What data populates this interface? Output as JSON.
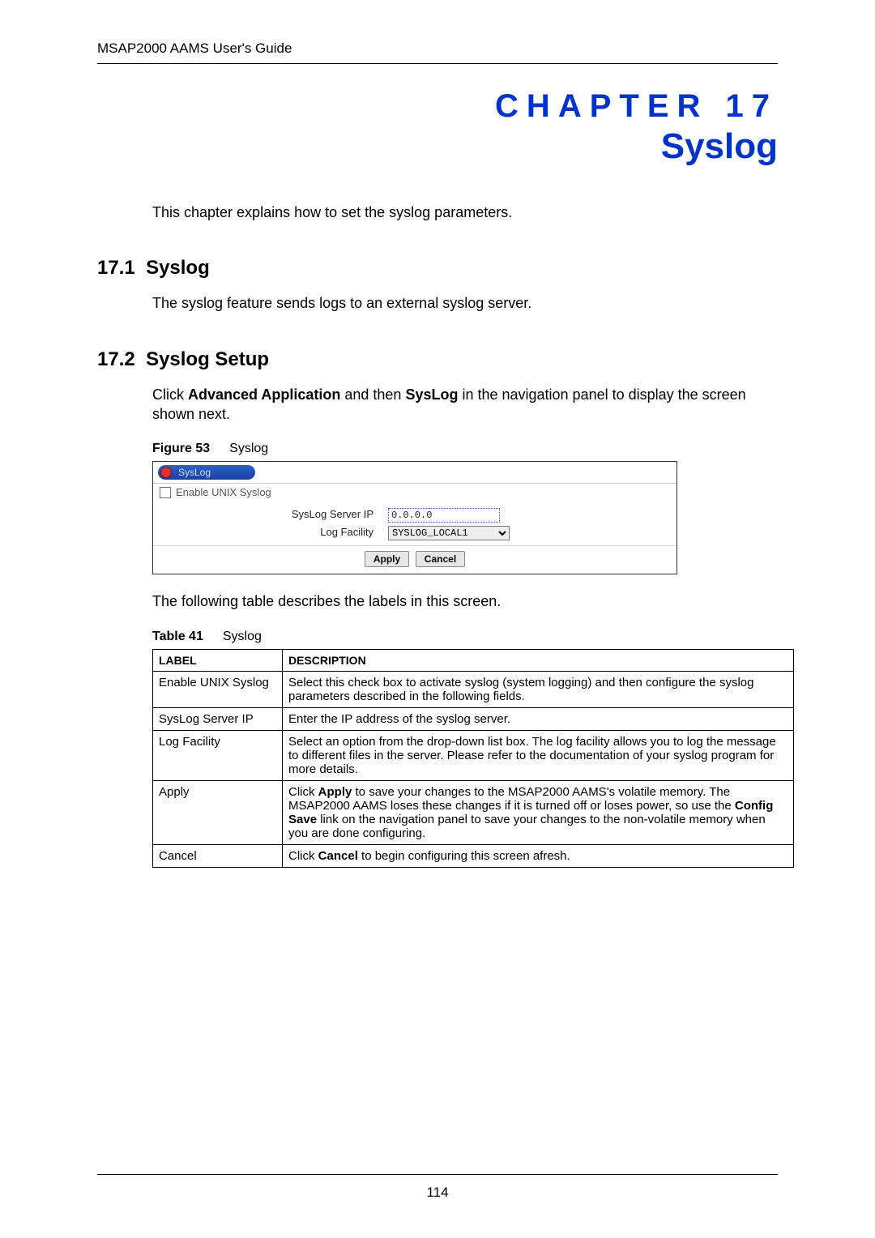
{
  "header": {
    "doc_title": "MSAP2000 AAMS User's Guide"
  },
  "chapter": {
    "label": "CHAPTER 17",
    "title": "Syslog",
    "intro": "This chapter explains how to set the syslog parameters."
  },
  "section1": {
    "number": "17.1",
    "title": "Syslog",
    "body": "The syslog feature sends logs to an external syslog server."
  },
  "section2": {
    "number": "17.2",
    "title": "Syslog Setup",
    "body_pre": "Click ",
    "body_b1": "Advanced Application",
    "body_mid1": " and then ",
    "body_b2": "SysLog",
    "body_post": " in the navigation panel to display the screen shown next."
  },
  "figure": {
    "caption_label": "Figure 53",
    "caption_text": "Syslog",
    "panel_title": "SysLog",
    "enable_label": "Enable UNIX Syslog",
    "enable_checked": false,
    "row_server_label": "SysLog Server IP",
    "row_server_value": "0.0.0.0",
    "row_facility_label": "Log Facility",
    "row_facility_value": "SYSLOG_LOCAL1",
    "apply_label": "Apply",
    "cancel_label": "Cancel"
  },
  "between_text": "The following table describes the labels in this screen.",
  "table": {
    "caption_label": "Table 41",
    "caption_text": "Syslog",
    "header_label": "LABEL",
    "header_desc": "DESCRIPTION",
    "rows": [
      {
        "label": "Enable UNIX Syslog",
        "desc": "Select this check box to activate syslog (system logging) and then configure the syslog parameters described in the following fields."
      },
      {
        "label": "SysLog Server IP",
        "desc": "Enter the IP address of the syslog server."
      },
      {
        "label": "Log Facility",
        "desc": "Select an option from the drop-down list box. The log facility allows you to log the message to different files in the server. Please refer to the documentation of your syslog program for more details."
      },
      {
        "label": "Apply",
        "desc_pre": "Click ",
        "b1": "Apply",
        "mid1": " to save your changes to the MSAP2000 AAMS's volatile memory. The MSAP2000 AAMS loses these changes if it is turned off or loses power, so use the ",
        "b2": "Config Save",
        "post": " link on the navigation panel to save your changes to the non-volatile memory when you are done configuring."
      },
      {
        "label": "Cancel",
        "desc_pre": "Click ",
        "b1": "Cancel",
        "post": " to begin configuring this screen afresh."
      }
    ]
  },
  "page_number": "114"
}
